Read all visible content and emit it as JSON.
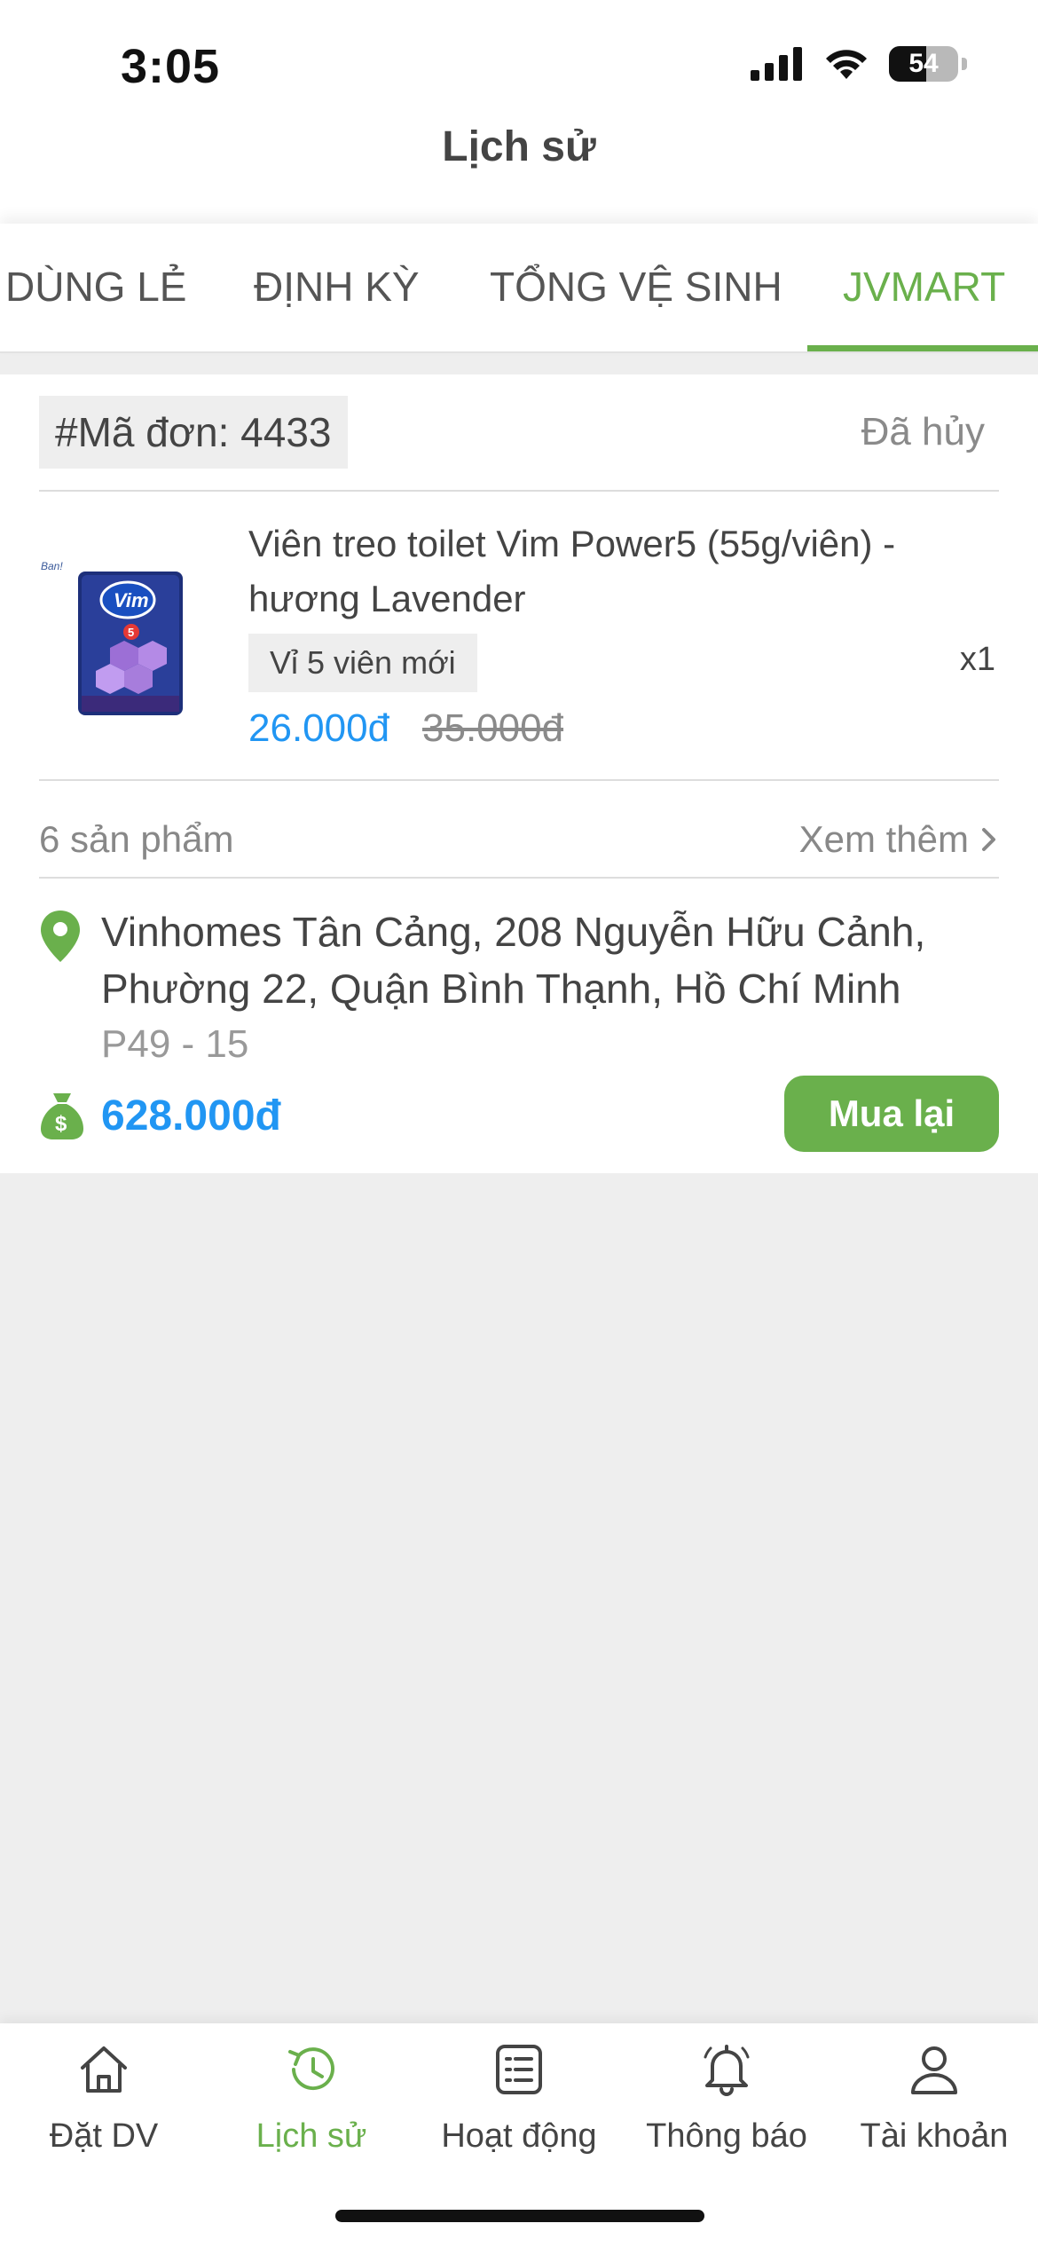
{
  "status_bar": {
    "time": "3:05",
    "battery": "54"
  },
  "header": {
    "title": "Lịch sử"
  },
  "tabs": [
    {
      "label": "DÙNG LẺ",
      "active": false
    },
    {
      "label": "ĐỊNH KỲ",
      "active": false
    },
    {
      "label": "TỔNG VỆ SINH",
      "active": false
    },
    {
      "label": "JVMART",
      "active": true
    }
  ],
  "order": {
    "id_label": "#Mã đơn: 4433",
    "status": "Đã hủy",
    "product": {
      "name": "Viên treo toilet Vim Power5 (55g/viên) - hương Lavender",
      "variant": "Vỉ 5 viên mới",
      "quantity": "x1",
      "price": "26.000đ",
      "old_price": "35.000đ"
    },
    "product_count": "6 sản phẩm",
    "see_more": "Xem thêm",
    "address": "Vinhomes Tân Cảng,  208 Nguyễn Hữu Cảnh, Phường 22, Quận Bình Thạnh, Hồ Chí Minh",
    "room": "P49 - 15",
    "total": "628.000đ",
    "buy_again": "Mua lại"
  },
  "bottom_nav": [
    {
      "label": "Đặt DV",
      "icon": "home-icon",
      "active": false
    },
    {
      "label": "Lịch sử",
      "icon": "history-icon",
      "active": true
    },
    {
      "label": "Hoạt động",
      "icon": "list-icon",
      "active": false
    },
    {
      "label": "Thông báo",
      "icon": "bell-icon",
      "active": false
    },
    {
      "label": "Tài khoản",
      "icon": "user-icon",
      "active": false
    }
  ],
  "colors": {
    "accent_green": "#6ab04c",
    "price_blue": "#2196f3",
    "background": "#eeeeee"
  }
}
